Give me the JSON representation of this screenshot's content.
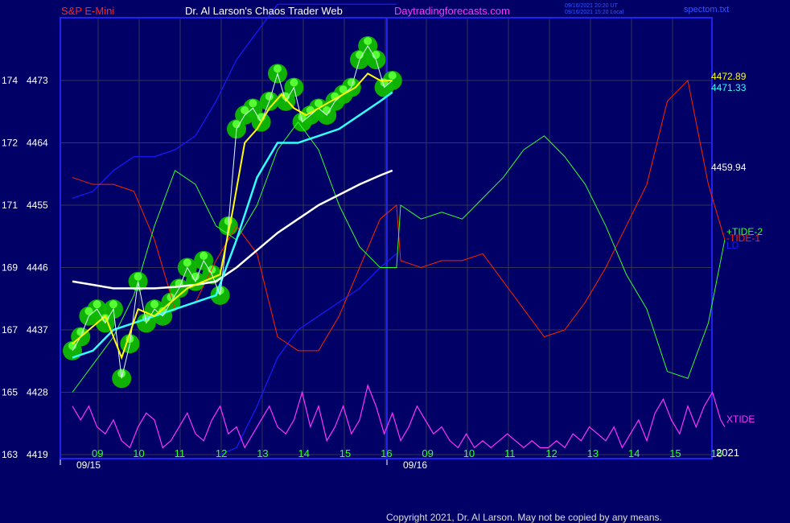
{
  "header": {
    "symbol": "S&P E-Mini",
    "author": "Dr. Al Larson's Chaos Trader Web",
    "site": "Daytradingforecasts.com",
    "stamp_line1": "09/16/2021 20:20 UT",
    "stamp_line2": "09/16/2021 15:20 Local",
    "file": "spectom.txt"
  },
  "copyright": "Copyright 2021, Dr. Al Larson. May not be copied by any means.",
  "colors": {
    "background": "#000066",
    "frame": "#2222ee",
    "grid": "#333355",
    "price": "#e0ffff",
    "yellow": "#ffff00",
    "magenta_ma": "#ff33ff",
    "cyan_ma": "#33ffff",
    "white_ma": "#ffffff",
    "blue_band": "#1a1aff",
    "tide1": "#ff2200",
    "tide2": "#33ff33",
    "xtide": "#ff33ff",
    "glow": "#11bb00"
  },
  "chart_data": {
    "type": "line",
    "ylim": [
      4419,
      4484
    ],
    "y_ticks": [
      {
        "left": "163",
        "price": "4419",
        "value": 4419
      },
      {
        "left": "165",
        "price": "4428",
        "value": 4428
      },
      {
        "left": "167",
        "price": "4437",
        "value": 4437
      },
      {
        "left": "169",
        "price": "4446",
        "value": 4446
      },
      {
        "left": "171",
        "price": "4455",
        "value": 4455
      },
      {
        "left": "172",
        "price": "4464",
        "value": 4464
      },
      {
        "left": "174",
        "price": "4473",
        "value": 4473
      }
    ],
    "x_ticks": [
      "09",
      "10",
      "11",
      "12",
      "13",
      "14",
      "15",
      "16",
      "09",
      "10",
      "11",
      "12",
      "13",
      "14",
      "15",
      "16"
    ],
    "x_axis_year": "2021",
    "date_labels": [
      {
        "text": "09/15",
        "slot": 0
      },
      {
        "text": "09/16",
        "slot": 8
      }
    ],
    "right_values": [
      {
        "text": "4472.89",
        "value": 4472.89,
        "color": "#ffff00"
      },
      {
        "text": "4471.33",
        "value": 4471.33,
        "color": "#33ffff"
      },
      {
        "text": "4459.94",
        "value": 4459.94,
        "color": "#ffffff"
      }
    ],
    "legend": [
      {
        "text": "+TIDE-2",
        "color": "#33ff33"
      },
      {
        "text": "-TIDE-1",
        "color": "#ff2200"
      },
      {
        "text": "LD",
        "color": "#1a1aff"
      },
      {
        "text": "XTIDE",
        "color": "#ff33ff"
      }
    ],
    "series": [
      {
        "name": "price",
        "x": [
          0.0,
          0.2,
          0.4,
          0.6,
          0.8,
          1.0,
          1.2,
          1.4,
          1.6,
          1.8,
          2.0,
          2.2,
          2.4,
          2.6,
          2.8,
          3.0,
          3.2,
          3.4,
          3.6,
          3.8,
          4.0,
          4.2,
          4.4,
          4.6,
          4.8,
          5.0,
          5.2,
          5.4,
          5.6,
          5.8,
          6.0,
          6.2,
          6.4,
          6.6,
          6.8,
          7.0,
          7.2,
          7.4,
          7.6,
          7.8
        ],
        "values": [
          4434,
          4436,
          4439,
          4440,
          4438,
          4440,
          4430,
          4435,
          4444,
          4438,
          4440,
          4439,
          4441,
          4443,
          4446,
          4444,
          4447,
          4445,
          4442,
          4452,
          4466,
          4468,
          4469,
          4467,
          4470,
          4474,
          4470,
          4472,
          4467,
          4468,
          4469,
          4468,
          4470,
          4471,
          4472,
          4476,
          4478,
          4476,
          4472,
          4473
        ]
      },
      {
        "name": "yellow",
        "x": [
          0.0,
          0.4,
          0.8,
          1.2,
          1.6,
          2.0,
          2.4,
          2.8,
          3.2,
          3.6,
          3.9,
          4.2,
          4.5,
          4.8,
          5.1,
          5.4,
          5.7,
          6.0,
          6.3,
          6.6,
          6.9,
          7.2,
          7.5,
          7.8
        ],
        "values": [
          4435,
          4437,
          4439,
          4433,
          4440,
          4439,
          4441,
          4443,
          4444,
          4445,
          4454,
          4464,
          4466,
          4469,
          4471,
          4469,
          4468,
          4469,
          4470,
          4471,
          4472,
          4474,
          4473,
          4473
        ]
      },
      {
        "name": "cyan",
        "x": [
          0.0,
          0.5,
          1.0,
          1.5,
          2.0,
          2.5,
          3.0,
          3.5,
          4.0,
          4.5,
          5.0,
          5.5,
          6.0,
          6.5,
          7.0,
          7.5,
          7.8
        ],
        "values": [
          4433,
          4434,
          4437,
          4438,
          4439,
          4440,
          4441,
          4442,
          4450,
          4459,
          4464,
          4464,
          4465,
          4466,
          4468,
          4470,
          4471.3
        ]
      },
      {
        "name": "white",
        "x": [
          0.0,
          0.5,
          1.0,
          1.5,
          2.0,
          2.5,
          3.0,
          3.5,
          4.0,
          4.5,
          5.0,
          5.5,
          6.0,
          6.5,
          7.0,
          7.5,
          7.8
        ],
        "values": [
          4444,
          4443.5,
          4443,
          4443,
          4443,
          4443.2,
          4443.5,
          4444,
          4446,
          4448.5,
          4451,
          4453,
          4455,
          4456.5,
          4458,
          4459.3,
          4460
        ]
      },
      {
        "name": "LD",
        "x": [
          0.0,
          0.5,
          1.0,
          1.5,
          2.0,
          2.5,
          3.0,
          3.5,
          4.0,
          4.5,
          5.0,
          5.5,
          6.0,
          6.5,
          7.0,
          7.5,
          7.9
        ],
        "values": [
          4456,
          4457,
          4460,
          4462,
          4462,
          4463,
          4465,
          4470,
          4476,
          4480,
          4484,
          4484,
          4484,
          4484,
          4484,
          4484,
          4484
        ]
      },
      {
        "name": "LD-lower",
        "x": [
          3.6,
          4.0,
          4.5,
          5.0,
          5.5,
          6.0,
          6.5,
          7.0,
          7.5,
          7.9
        ],
        "values": [
          4419,
          4420,
          4426,
          4433,
          4437,
          4439,
          4441,
          4443,
          4446,
          4448
        ]
      },
      {
        "name": "-TIDE-1",
        "x": [
          0.0,
          0.5,
          1.0,
          1.5,
          2.0,
          2.5,
          3.0,
          3.5,
          4.0,
          4.5,
          5.0,
          5.5,
          6.0,
          6.5,
          7.0,
          7.5,
          7.9,
          8.0,
          8.5,
          9.0,
          9.5,
          10.0,
          10.5,
          11.0,
          11.5,
          12.0,
          12.5,
          13.0,
          13.5,
          14.0,
          14.5,
          15.0,
          15.5,
          15.9
        ],
        "values": [
          4459,
          4458,
          4458,
          4457,
          4450,
          4440,
          4441,
          4447,
          4452,
          4448,
          4436,
          4434,
          4434,
          4439,
          4446,
          4453,
          4455,
          4447,
          4446,
          4447,
          4447,
          4448,
          4444,
          4440,
          4436,
          4437,
          4441,
          4446,
          4452,
          4458,
          4470,
          4473,
          4458,
          4450
        ]
      },
      {
        "name": "+TIDE-2",
        "x": [
          0.0,
          0.5,
          1.0,
          1.5,
          2.0,
          2.5,
          3.0,
          3.5,
          4.0,
          4.5,
          5.0,
          5.5,
          6.0,
          6.5,
          7.0,
          7.5,
          7.9,
          8.0,
          8.5,
          9.0,
          9.5,
          10.0,
          10.5,
          11.0,
          11.5,
          12.0,
          12.5,
          13.0,
          13.5,
          14.0,
          14.5,
          15.0,
          15.5,
          15.9
        ],
        "values": [
          4428,
          4432,
          4436,
          4442,
          4452,
          4460,
          4458,
          4452,
          4450,
          4455,
          4463,
          4467,
          4463,
          4455,
          4449,
          4446,
          4446,
          4455,
          4453,
          4454,
          4453,
          4456,
          4459,
          4463,
          4465,
          4462,
          4458,
          4452,
          4445,
          4440,
          4431,
          4430,
          4438,
          4450
        ]
      },
      {
        "name": "XTIDE",
        "x": [
          0.0,
          0.2,
          0.4,
          0.6,
          0.8,
          1.0,
          1.2,
          1.4,
          1.6,
          1.8,
          2.0,
          2.2,
          2.4,
          2.6,
          2.8,
          3.0,
          3.2,
          3.4,
          3.6,
          3.8,
          4.0,
          4.2,
          4.4,
          4.6,
          4.8,
          5.0,
          5.2,
          5.4,
          5.6,
          5.8,
          6.0,
          6.2,
          6.4,
          6.6,
          6.8,
          7.0,
          7.2,
          7.4,
          7.6,
          7.8,
          8.0,
          8.2,
          8.4,
          8.6,
          8.8,
          9.0,
          9.2,
          9.4,
          9.6,
          9.8,
          10.0,
          10.2,
          10.4,
          10.6,
          10.8,
          11.0,
          11.2,
          11.4,
          11.6,
          11.8,
          12.0,
          12.2,
          12.4,
          12.6,
          12.8,
          13.0,
          13.2,
          13.4,
          13.6,
          13.8,
          14.0,
          14.2,
          14.4,
          14.6,
          14.8,
          15.0,
          15.2,
          15.4,
          15.6,
          15.8,
          15.9
        ],
        "values": [
          4426,
          4424,
          4426,
          4423,
          4422,
          4424,
          4421,
          4420,
          4423,
          4425,
          4424,
          4420,
          4421,
          4423,
          4425,
          4422,
          4421,
          4424,
          4426,
          4422,
          4423,
          4420,
          4422,
          4424,
          4426,
          4423,
          4422,
          4424,
          4428,
          4423,
          4426,
          4421,
          4423,
          4426,
          4422,
          4424,
          4429,
          4426,
          4422,
          4425,
          4421,
          4423,
          4426,
          4424,
          4422,
          4423,
          4421,
          4420,
          4422,
          4420,
          4421,
          4420,
          4421,
          4422,
          4421,
          4420,
          4421,
          4420,
          4420,
          4421,
          4420,
          4422,
          4421,
          4423,
          4422,
          4421,
          4423,
          4420,
          4422,
          4424,
          4421,
          4425,
          4427,
          4424,
          4422,
          4426,
          4423,
          4426,
          4428,
          4424,
          4423
        ]
      }
    ]
  }
}
